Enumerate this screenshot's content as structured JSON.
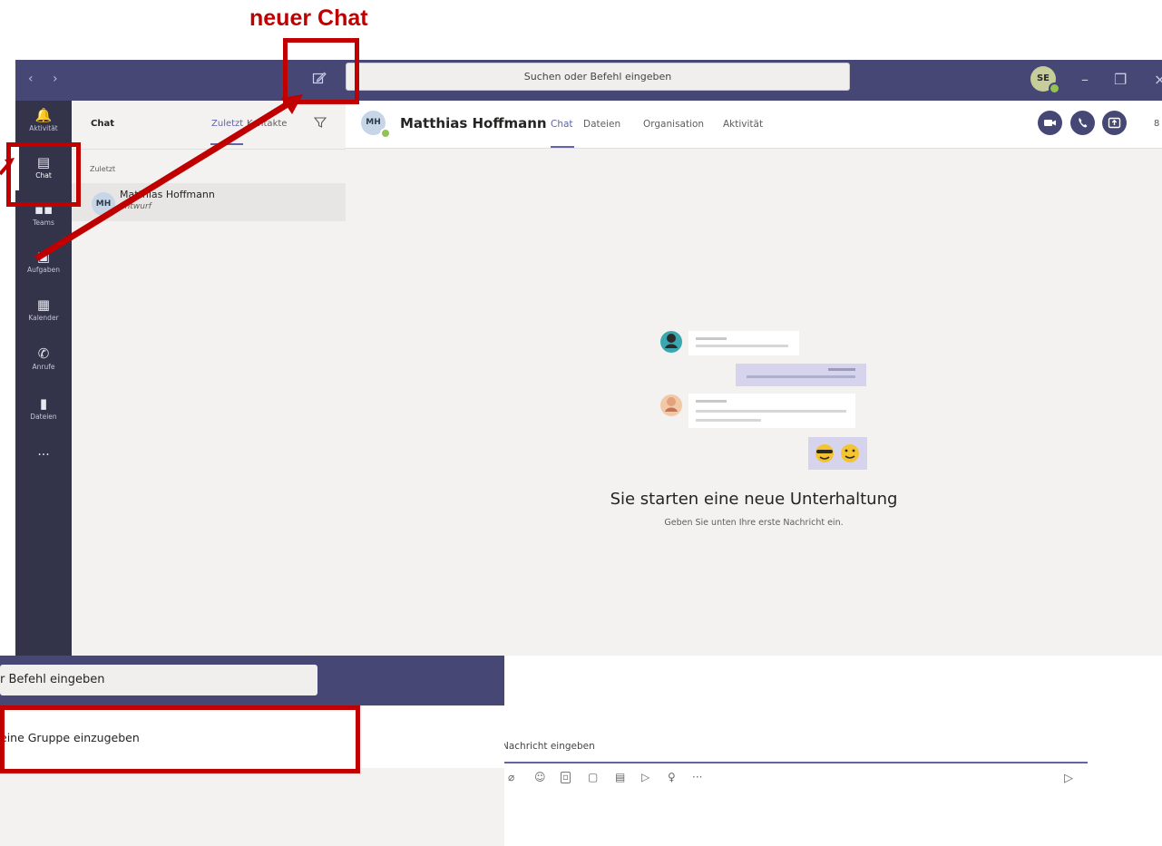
{
  "annotation": {
    "label": "neuer Chat",
    "color": "#c00000"
  },
  "titlebar": {
    "back_icon": "chevron-left-icon",
    "forward_icon": "chevron-right-icon",
    "compose_icon": "compose-icon",
    "search_placeholder": "Suchen oder Befehl eingeben",
    "user_initials": "SE",
    "minimize": "–",
    "restore": "❐",
    "close": "×",
    "accent": "#464775"
  },
  "rail": {
    "items": [
      {
        "label": "Aktivität",
        "icon": "bell-icon",
        "glyph": "🔔"
      },
      {
        "label": "Chat",
        "icon": "chat-icon",
        "glyph": "▤"
      },
      {
        "label": "Teams",
        "icon": "teams-icon",
        "glyph": "▪▪"
      },
      {
        "label": "Aufgaben",
        "icon": "tasks-icon",
        "glyph": "▣"
      },
      {
        "label": "Kalender",
        "icon": "calendar-icon",
        "glyph": "▦"
      },
      {
        "label": "Anrufe",
        "icon": "phone-icon",
        "glyph": "✆"
      },
      {
        "label": "Dateien",
        "icon": "file-icon",
        "glyph": "▮"
      }
    ],
    "more": "···",
    "active": "Chat"
  },
  "chat_panel": {
    "title": "Chat",
    "tab_recent": "Zuletzt",
    "tab_contacts": "Kontakte",
    "section_label": "Zuletzt",
    "conversation": {
      "initials": "MH",
      "name": "Matthias Hoffmann",
      "status": "Entwurf"
    }
  },
  "main": {
    "contact_initials": "MH",
    "contact_name": "Matthias Hoffmann",
    "tabs": [
      "Chat",
      "Dateien",
      "Organisation",
      "Aktivität"
    ],
    "active_tab": "Chat",
    "edge_text": "8",
    "empty_title": "Sie starten eine neue Unterhaltung",
    "empty_subtitle": "Geben Sie unten Ihre erste Nachricht ein.",
    "compose_placeholder": "Nachricht eingeben",
    "compose_tools": [
      "paperclip-icon",
      "emoji-icon",
      "gif-icon",
      "sticker-icon",
      "meeting-icon",
      "stream-icon",
      "praise-icon",
      "more-icon"
    ],
    "send_icon": "send-icon"
  },
  "overlay": {
    "search_text": "r Befehl eingeben",
    "hint_text": "eine Gruppe einzugeben"
  }
}
